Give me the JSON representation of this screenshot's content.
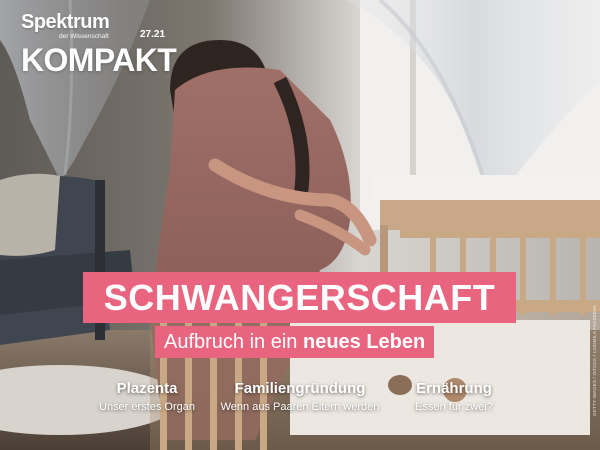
{
  "masthead": {
    "brand": "Spektrum",
    "brand_sub": "der Wissenschaft",
    "series": "KOMPAKT",
    "issue": "27.21"
  },
  "headline": "SCHWANGERSCHAFT",
  "subheadline": {
    "normal": "Aufbruch in ein ",
    "bold": "neues Leben"
  },
  "topics": [
    {
      "title": "Plazenta",
      "subtitle": "Unser erstes Organ"
    },
    {
      "title": "Familiengründung",
      "subtitle": "Wenn aus Paaren Eltern werden"
    },
    {
      "title": "Ernährung",
      "subtitle": "Essen für zwei?"
    }
  ],
  "photo_credit": "GETTY IMAGES / ISTOCK / LIUDMILA FADZEEVA",
  "colors": {
    "accent": "#e9647e",
    "text": "#ffffff"
  }
}
